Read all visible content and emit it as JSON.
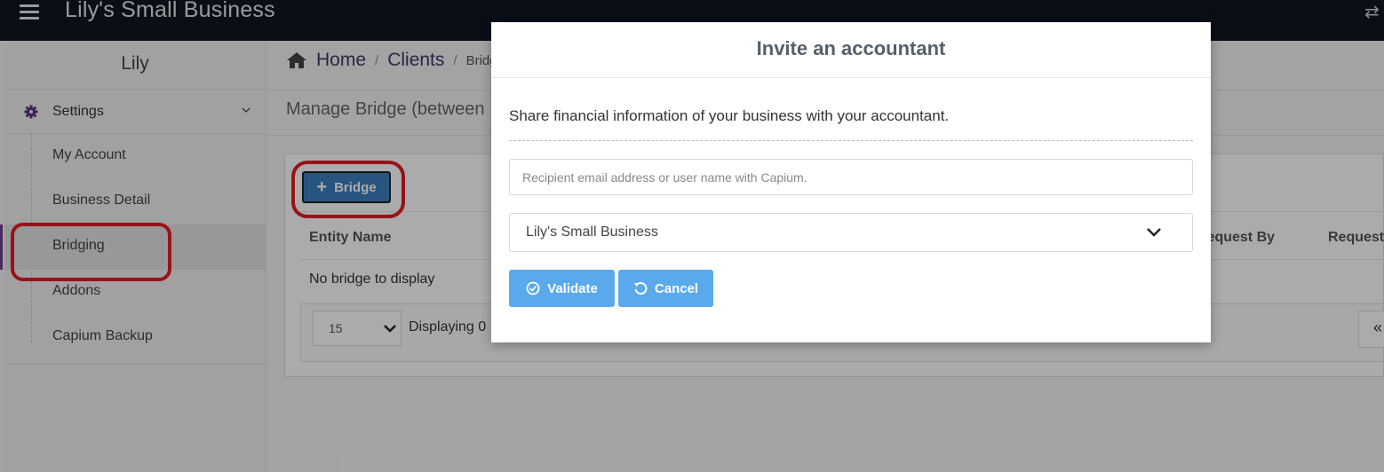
{
  "app": {
    "title": "Lily's Small Business"
  },
  "sidebar": {
    "user": "Lily",
    "settings_label": "Settings",
    "items": [
      {
        "label": "My Account"
      },
      {
        "label": "Business Detail"
      },
      {
        "label": "Bridging"
      },
      {
        "label": "Addons"
      },
      {
        "label": "Capium Backup"
      }
    ]
  },
  "breadcrumb": {
    "home": "Home",
    "clients": "Clients",
    "current": "Bridg"
  },
  "page": {
    "heading": "Manage Bridge (between"
  },
  "toolbar": {
    "bridge_label": "Bridge"
  },
  "table": {
    "columns": [
      "Entity Name",
      "Request By",
      "Request"
    ],
    "empty": "No bridge to display",
    "page_size": "15",
    "displaying": "Displaying 0",
    "nav": "«"
  },
  "modal": {
    "title": "Invite an accountant",
    "description": "Share financial information of your business with your accountant.",
    "email_placeholder": "Recipient email address or user name with Capium.",
    "business": "Lily's Small Business",
    "validate_label": "Validate",
    "cancel_label": "Cancel"
  },
  "colors": {
    "topbar": "#0f1623",
    "accent": "#6f3d8a",
    "primary_button": "#3d7ebf",
    "modal_button": "#5aa9ec",
    "annotation": "#e31b23"
  }
}
